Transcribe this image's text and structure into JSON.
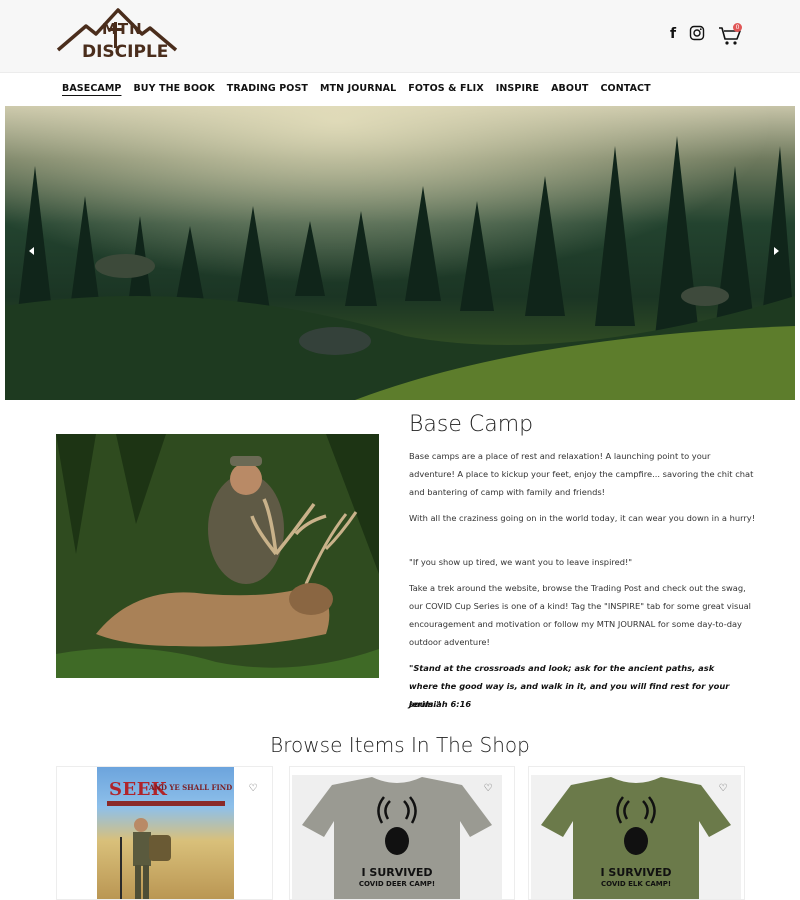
{
  "brand": {
    "logo_line1": "MTN",
    "logo_line2": "DISCIPLE"
  },
  "header": {
    "social_facebook_icon": "facebook-icon",
    "social_instagram_icon": "instagram-icon",
    "cart_icon": "cart-icon",
    "cart_count": "0"
  },
  "nav": {
    "items": [
      {
        "label": "BASECAMP",
        "active": true
      },
      {
        "label": "BUY THE BOOK",
        "active": false
      },
      {
        "label": "TRADING POST",
        "active": false
      },
      {
        "label": "MTN JOURNAL",
        "active": false
      },
      {
        "label": "FOTOS & FLIX",
        "active": false
      },
      {
        "label": "INSPIRE",
        "active": false
      },
      {
        "label": "ABOUT",
        "active": false
      },
      {
        "label": "CONTACT",
        "active": false
      }
    ]
  },
  "hero": {
    "prev_icon": "chevron-left-icon",
    "next_icon": "chevron-right-icon"
  },
  "basecamp": {
    "title": "Base Camp",
    "paragraphs": [
      "Base camps are a place of rest and relaxation! A launching point to your adventure! A place to kickup your feet, enjoy the campfire... savoring the chit chat and bantering of camp with family and friends!",
      "With all the craziness going on in the world today, it can wear you down in a hurry!",
      "\"If you show up tired, we want you to leave inspired!\"",
      "Take a trek around the website, browse the Trading Post and check out the swag, our COVID Cup Series is one of a kind! Tag the \"INSPIRE\" tab for some great visual encouragement and motivation or follow my MTN JOURNAL for some day-to-day outdoor adventure!"
    ],
    "quote": "\"Stand at the crossroads and look; ask for the ancient paths, ask where the good way is, and walk in it, and you will find rest for your souls.\"",
    "quote_ref": "Jerimiah 6:16"
  },
  "shop": {
    "title": "Browse Items In The Shop",
    "products": [
      {
        "book_title": "SEEK",
        "book_subtitle": "AND YE SHALL FIND"
      },
      {
        "shirt_text": "I SURVIVED",
        "shirt_sub": "COVID DEER CAMP!"
      },
      {
        "shirt_text": "I SURVIVED",
        "shirt_sub": "COVID ELK CAMP!"
      }
    ]
  },
  "colors": {
    "brand_brown": "#4a2d1c",
    "badge_red": "#e05656",
    "shirt_grey": "#9a9a92",
    "shirt_green": "#6b7a4a"
  }
}
